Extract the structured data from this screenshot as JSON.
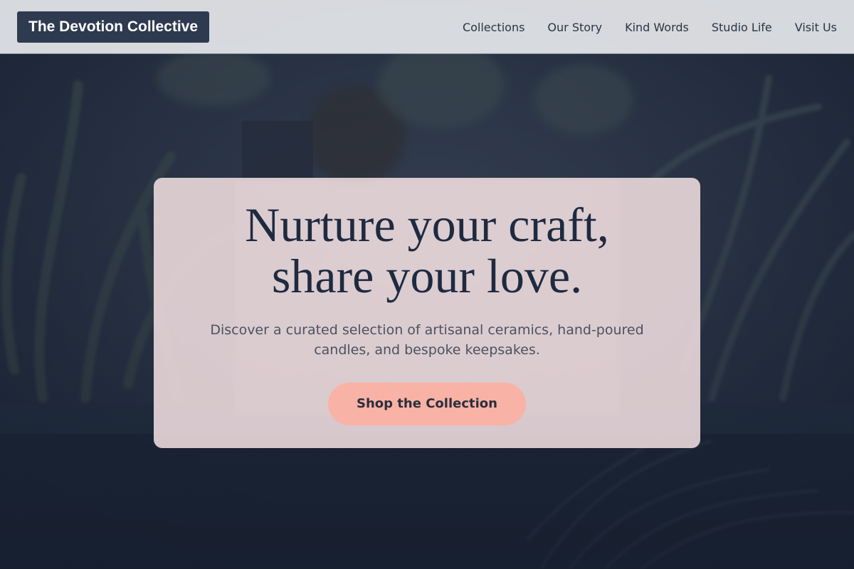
{
  "header": {
    "logo": "The Devotion Collective",
    "nav": [
      "Collections",
      "Our Story",
      "Kind Words",
      "Studio Life",
      "Visit Us"
    ]
  },
  "hero": {
    "title_line1": "Nurture your craft,",
    "title_line2": "share your love.",
    "subtitle": "Discover a curated selection of artisanal ceramics, hand-poured candles, and bespoke keepsakes.",
    "cta_label": "Shop the Collection"
  },
  "colors": {
    "header_bg": "#e2e4e8",
    "logo_bg": "#2e3a4f",
    "card_bg": "#f0dee0",
    "cta_bg": "#f9b2a6",
    "title_text": "#1e2a40"
  }
}
